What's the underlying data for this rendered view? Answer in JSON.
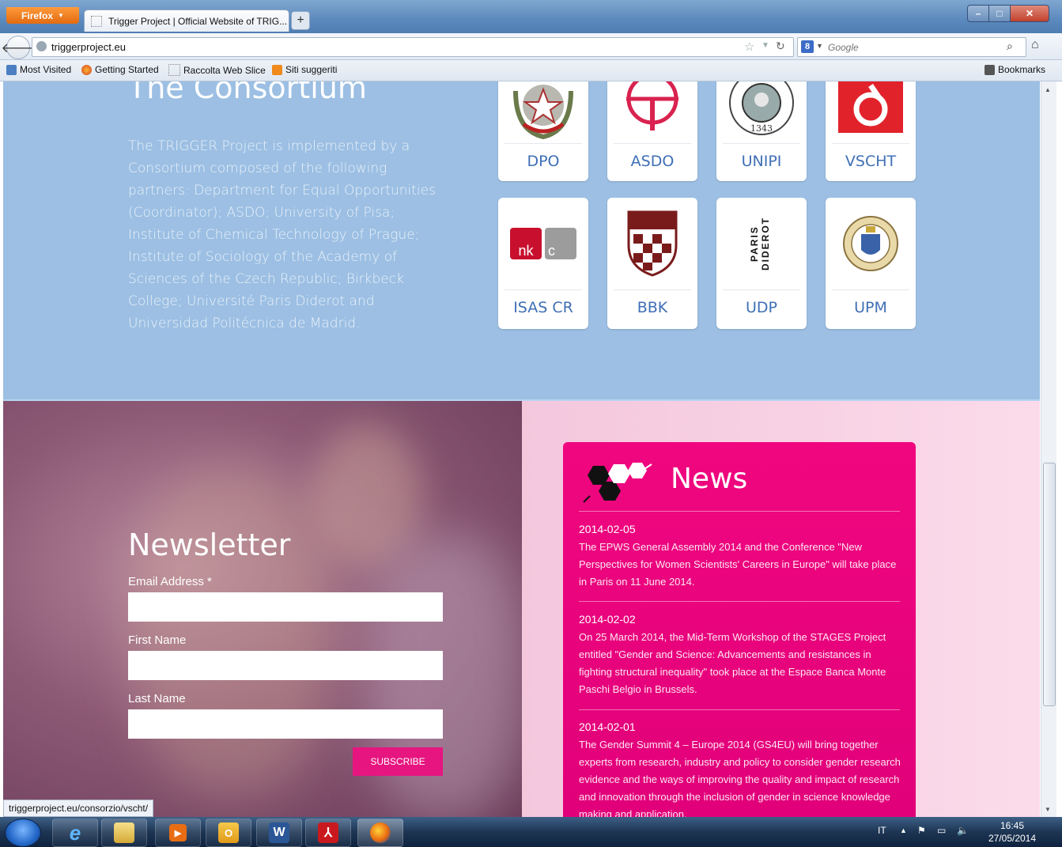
{
  "browser": {
    "menu_button": "Firefox",
    "tab_title": "Trigger Project | Official Website of TRIG...",
    "new_tab": "+",
    "url": "triggerproject.eu",
    "search_placeholder": "Google",
    "search_engine": "8",
    "bookmarks": {
      "items": [
        "Most Visited",
        "Getting Started",
        "Raccolta Web Slice",
        "Siti suggeriti"
      ],
      "menu": "Bookmarks"
    },
    "status_url": "triggerproject.eu/consorzio/vscht/"
  },
  "consortium": {
    "title": "The Consortium",
    "text": "The TRIGGER Project is implemented by a Consortium composed of the following partners: Department for Equal Opportunities (Coordinator); ASDO; University of Pisa; Institute of Chemical Technology of Prague; Institute of Sociology of the Academy of Sciences of the Czech Republic; Birkbeck College; Université Paris Diderot and Universidad Politécnica de Madrid.",
    "partners": [
      "DPO",
      "ASDO",
      "UNIPI",
      "VSCHT",
      "ISAS CR",
      "BBK",
      "UDP",
      "UPM"
    ],
    "logo_text": {
      "unipi_year": "1343",
      "isas_left": "nk",
      "isas_right": "c",
      "udp": "PARIS DIDEROT"
    }
  },
  "newsletter": {
    "title": "Newsletter",
    "email_label": "Email Address *",
    "first_name_label": "First Name",
    "last_name_label": "Last Name",
    "email_value": "",
    "first_name_value": "",
    "last_name_value": "",
    "subscribe": "SUBSCRIBE"
  },
  "news": {
    "title": "News",
    "items": [
      {
        "date": "2014-02-05",
        "text": "The EPWS General Assembly 2014 and the Conference \"New Perspectives for Women Scientists' Careers in Europe\" will take place in Paris on 11 June 2014."
      },
      {
        "date": "2014-02-02",
        "text": "On 25 March 2014, the Mid-Term Workshop of the STAGES Project entitled \"Gender and Science: Advancements and resistances in fighting structural inequality\" took place at the Espace Banca Monte Paschi Belgio in Brussels."
      },
      {
        "date": "2014-02-01",
        "text": "The Gender Summit 4 – Europe 2014 (GS4EU) will bring together experts from research, industry and policy to consider gender research evidence and the ways of improving the quality and impact of research and innovation through the inclusion of gender in science knowledge making and application."
      }
    ]
  },
  "taskbar": {
    "language": "IT",
    "time": "16:45",
    "date": "27/05/2014",
    "apps": [
      "start-button",
      "internet-explorer",
      "file-explorer",
      "media-player",
      "outlook",
      "word",
      "acrobat",
      "firefox"
    ]
  },
  "colors": {
    "consortium_bg": "#9cbfe3",
    "partner_label": "#3f6fb5",
    "news_pink": "#f0077f",
    "subscribe_pink": "#e6157f"
  }
}
